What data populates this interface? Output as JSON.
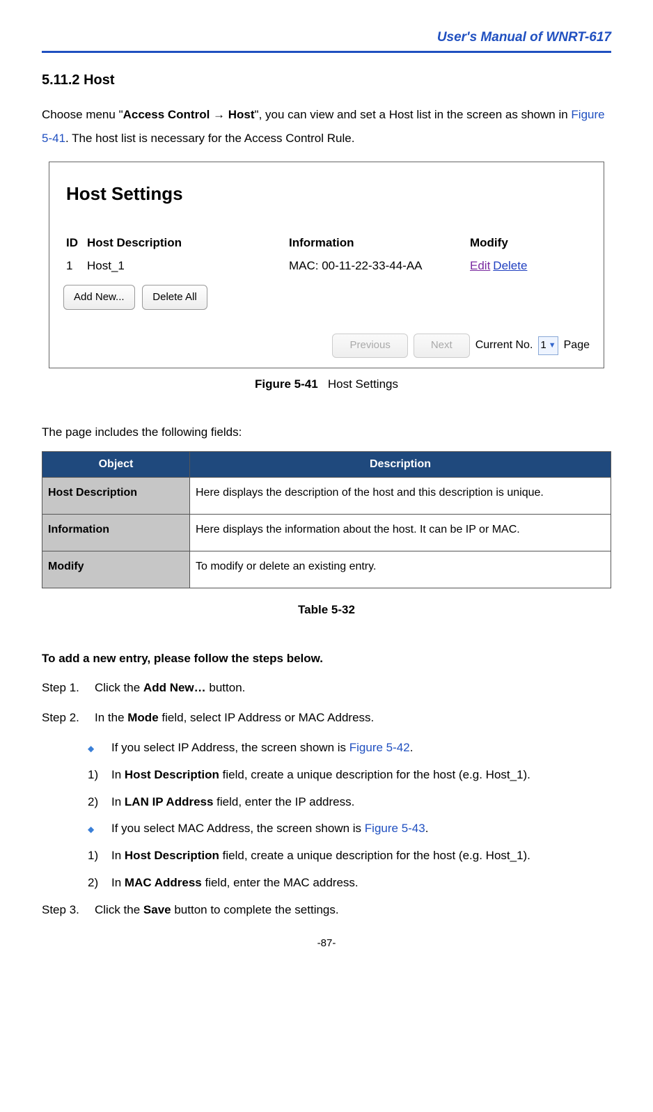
{
  "header": {
    "title": "User's Manual of WNRT-617"
  },
  "section": {
    "number": "5.11.2",
    "title": "Host"
  },
  "intro": {
    "p1_a": "Choose menu \"",
    "p1_b": "Access Control → Host",
    "p1_c": "\", you can view and set a Host list in the screen as shown in ",
    "figref": "Figure 5-41",
    "p1_d": ". The host list is necessary for the Access Control Rule."
  },
  "screenshot": {
    "title": "Host Settings",
    "headers": {
      "id": "ID",
      "desc": "Host Description",
      "info": "Information",
      "modify": "Modify"
    },
    "row": {
      "id": "1",
      "desc": "Host_1",
      "info": "MAC: 00-11-22-33-44-AA",
      "edit": "Edit",
      "delete": "Delete"
    },
    "buttons": {
      "add": "Add New...",
      "deleteAll": "Delete All",
      "prev": "Previous",
      "next": "Next"
    },
    "footer": {
      "current": "Current No.",
      "pageVal": "1",
      "pageLabel": "Page"
    }
  },
  "figcaption": {
    "label": "Figure 5-41",
    "text": "Host Settings"
  },
  "fieldsIntro": "The page includes the following fields:",
  "table": {
    "h1": "Object",
    "h2": "Description",
    "rows": [
      {
        "obj": "Host Description",
        "desc": "Here displays the description of the host and this description is unique."
      },
      {
        "obj": "Information",
        "desc": "Here displays the information about the host. It can be IP or MAC."
      },
      {
        "obj": "Modify",
        "desc": "To modify or delete an existing entry."
      }
    ],
    "caption": "Table 5-32"
  },
  "steps": {
    "title": "To add a new entry, please follow the steps below.",
    "s1": {
      "label": "Step 1.",
      "a": "Click the ",
      "b": "Add New…",
      "c": " button."
    },
    "s2": {
      "label": "Step 2.",
      "a": "In the ",
      "b": "Mode",
      "c": " field, select IP Address or MAC Address."
    },
    "ip": {
      "a": "If you select IP Address, the screen shown is ",
      "ref": "Figure 5-42",
      "c": "."
    },
    "ip1": {
      "n": "1)",
      "a": "In ",
      "b": "Host Description",
      "c": " field, create a unique description for the host (e.g. Host_1)."
    },
    "ip2": {
      "n": "2)",
      "a": "In ",
      "b": "LAN IP Address",
      "c": " field, enter the IP address."
    },
    "mac": {
      "a": "If you select MAC Address, the screen shown is ",
      "ref": "Figure 5-43",
      "c": "."
    },
    "mac1": {
      "n": "1)",
      "a": "In ",
      "b": "Host Description",
      "c": " field, create a unique description for the host (e.g. Host_1)."
    },
    "mac2": {
      "n": "2)",
      "a": "In ",
      "b": "MAC Address",
      "c": " field, enter the MAC address."
    },
    "s3": {
      "label": "Step 3.",
      "a": "Click the ",
      "b": "Save",
      "c": " button to complete the settings."
    }
  },
  "pagenum": "-87-"
}
